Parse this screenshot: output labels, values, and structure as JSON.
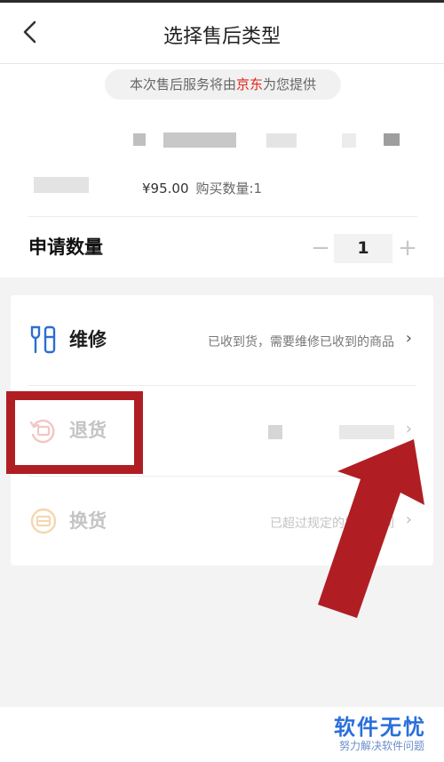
{
  "header": {
    "title": "选择售后类型",
    "back_icon": "chevron-left-icon"
  },
  "notice": {
    "prefix": "本次售后服务将由",
    "brand": "京东",
    "suffix": "为您提供",
    "brand_color": "#e2231a"
  },
  "product": {
    "price": "¥95.00",
    "purchase_qty_label": "购买数量:1"
  },
  "quantity": {
    "label": "申请数量",
    "minus": "−",
    "value": "1",
    "plus": "+"
  },
  "options": [
    {
      "label": "维修",
      "description": "已收到货，需要维修已收到的商品",
      "icon": "wrench-icon",
      "chevron": "›",
      "enabled": true
    },
    {
      "label": "退货",
      "description": "",
      "icon": "return-icon",
      "chevron": "›",
      "enabled": false
    },
    {
      "label": "换货",
      "description": "已超过规定的换货时间",
      "icon": "exchange-icon",
      "chevron": "›",
      "enabled": false
    }
  ],
  "annotation": {
    "highlight_color": "#b01e24"
  },
  "watermark": {
    "main": "软件无忧",
    "sub": "努力解决软件问题",
    "color": "#2a6fdb"
  }
}
